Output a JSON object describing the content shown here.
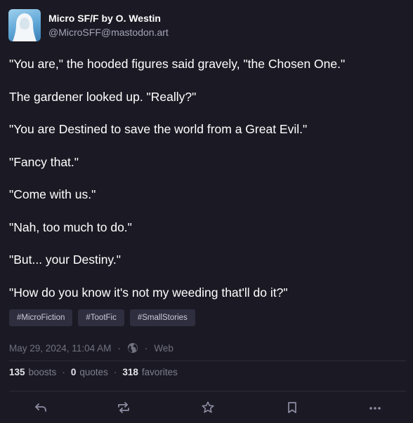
{
  "author": {
    "display_name": "Micro SF/F by O. Westin",
    "handle": "@MicroSFF@mastodon.art"
  },
  "paragraphs": [
    "\"You are,\" the hooded figures said gravely, \"the Chosen One.\"",
    "The gardener looked up. \"Really?\"",
    "\"You are Destined to save the world from a Great Evil.\"",
    "\"Fancy that.\"",
    "\"Come with us.\"",
    "\"Nah, too much to do.\"",
    "\"But... your Destiny.\"",
    "\"How do you know it's not my weeding that'll do it?\""
  ],
  "hashtags": [
    "#MicroFiction",
    "#TootFic",
    "#SmallStories"
  ],
  "meta": {
    "timestamp": "May 29, 2024, 11:04 AM",
    "separator": "·",
    "visibility_icon": "globe-icon",
    "client": "Web"
  },
  "stats": {
    "boosts_count": "135",
    "boosts_label": "boosts",
    "quotes_count": "0",
    "quotes_label": "quotes",
    "favorites_count": "318",
    "favorites_label": "favorites",
    "separator": "·"
  },
  "actions": [
    "reply-icon",
    "boost-icon",
    "favorite-icon",
    "bookmark-icon",
    "more-icon"
  ],
  "colors": {
    "background": "#1b1a24",
    "tag_background": "#2e2e3e",
    "muted_text": "#71717f",
    "icon": "#8d8da3"
  }
}
